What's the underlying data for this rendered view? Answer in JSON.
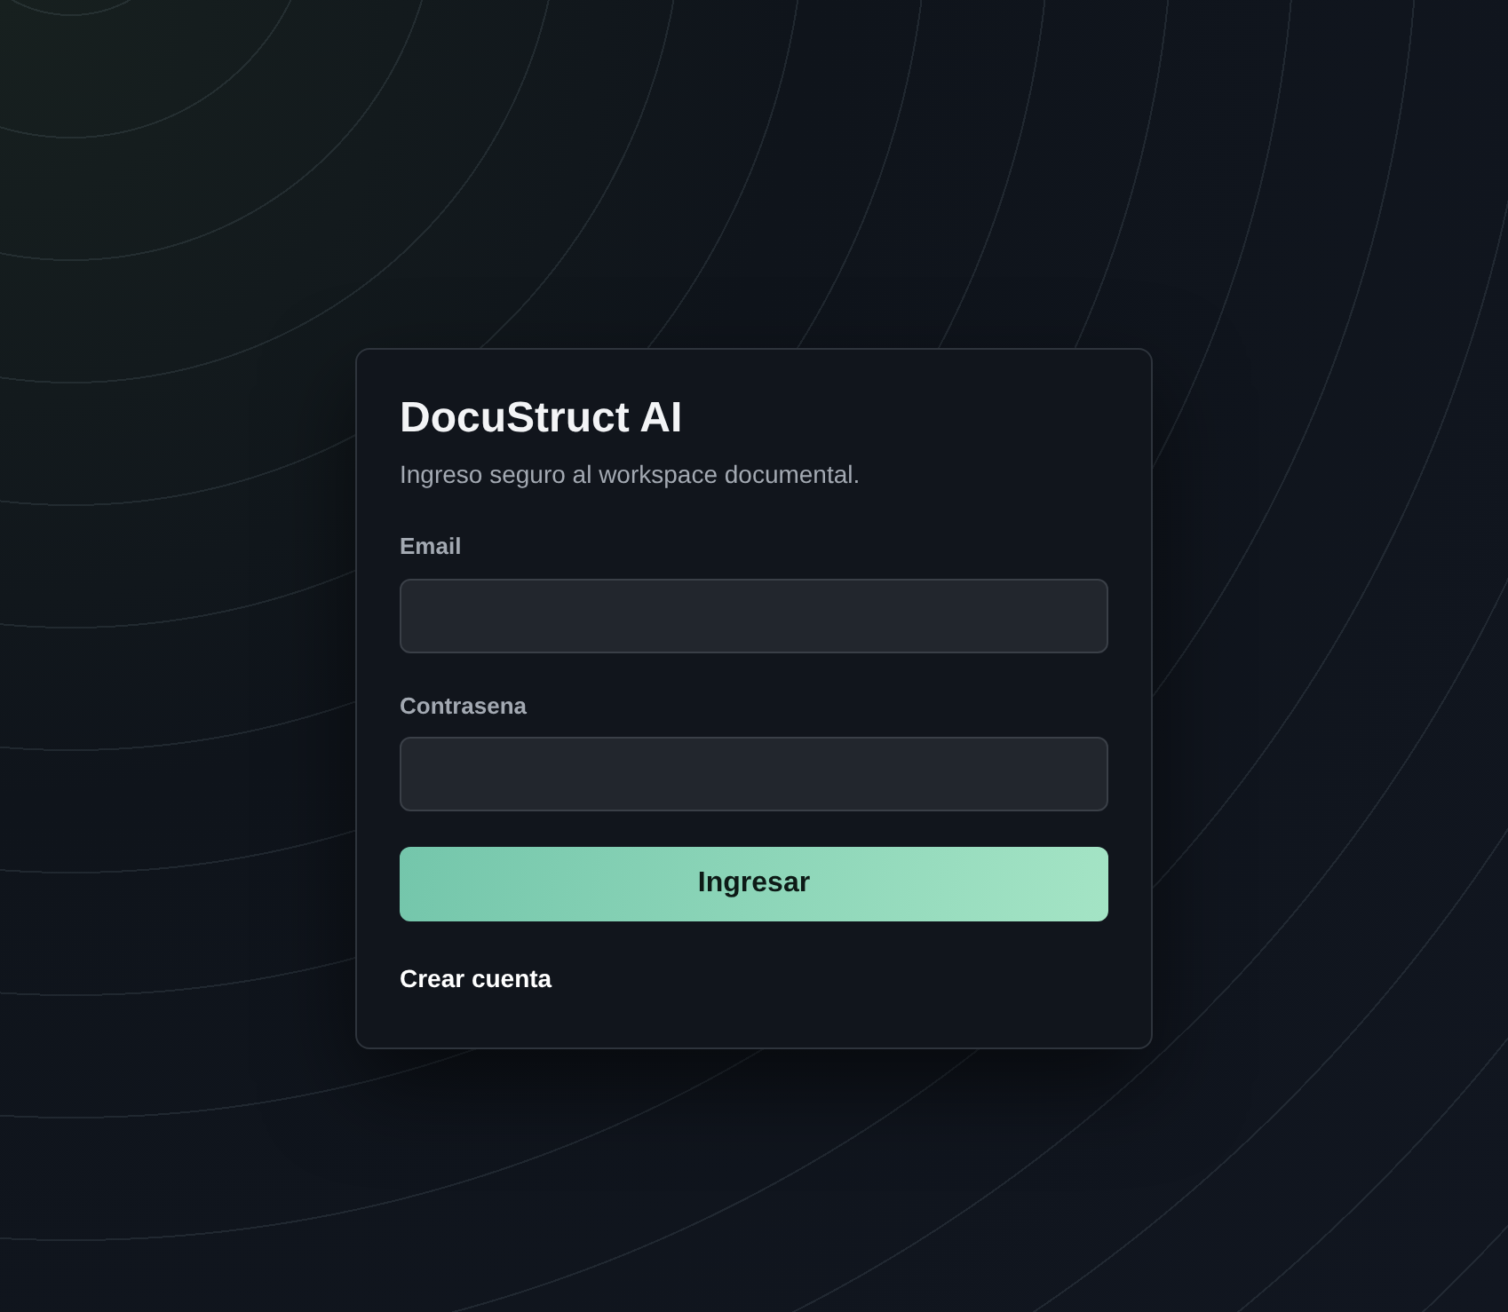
{
  "app": {
    "title": "DocuStruct AI",
    "subtitle": "Ingreso seguro al workspace documental."
  },
  "fields": [
    {
      "label": "Email"
    },
    {
      "label": "Contrasena"
    }
  ],
  "submit_button": "Ingresar",
  "link": "Crear cuenta"
}
